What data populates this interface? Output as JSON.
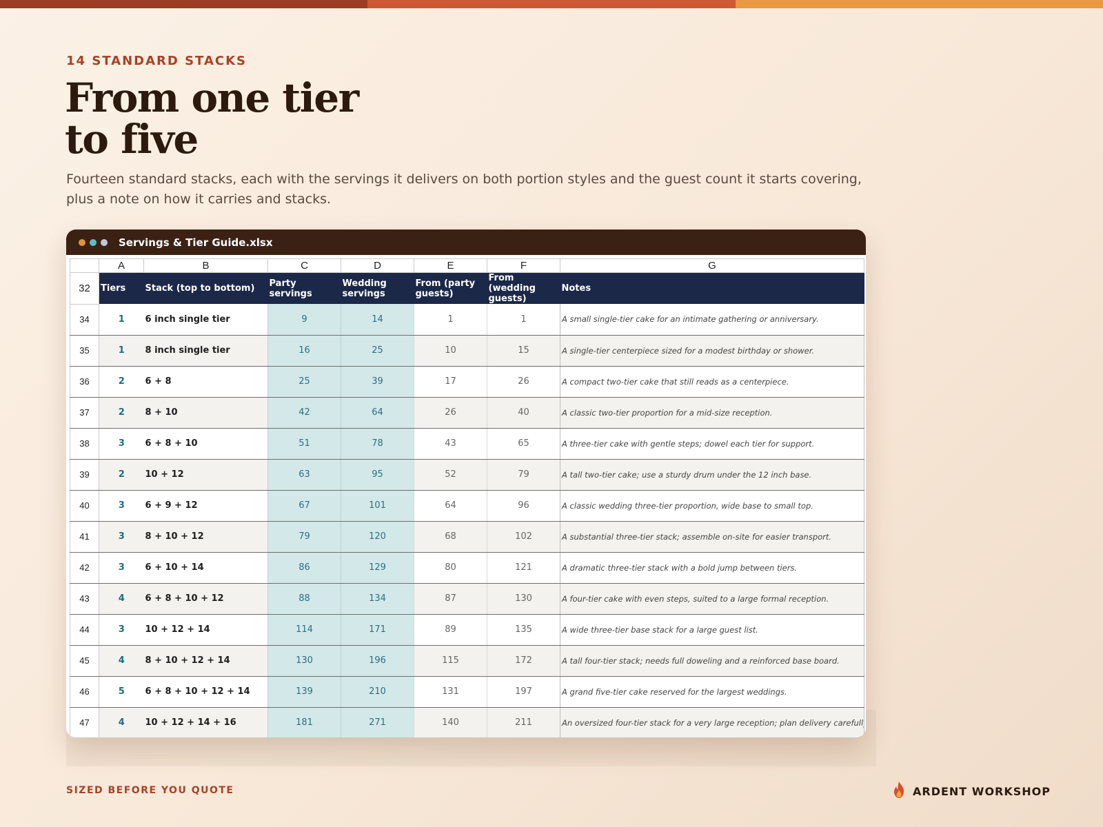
{
  "colors": {
    "top_bar": [
      "#9c3c22",
      "#cd5a35",
      "#e99942"
    ],
    "accent": "#a84226",
    "header_fill": "#1b2848",
    "servings_fill": "#d3e8e8",
    "titlebar": "#3b2114",
    "window_dots": [
      "#e98f3a",
      "#5bbfc4",
      "#c6c6d6"
    ]
  },
  "eyebrow": "14 STANDARD STACKS",
  "headline": {
    "line1": "From one tier",
    "line2": "to five"
  },
  "lede": "Fourteen standard stacks, each with the servings it delivers on both portion styles and the guest count it starts covering, plus a note on how it carries and stacks.",
  "window": {
    "title": "Servings & Tier Guide.xlsx"
  },
  "sheet": {
    "column_letters": [
      "A",
      "B",
      "C",
      "D",
      "E",
      "F",
      "G"
    ],
    "header_row_number": "32",
    "headers": [
      "Tiers",
      "Stack (top to bottom)",
      "Party servings",
      "Wedding servings",
      "From (party guests)",
      "From (wedding guests)",
      "Notes"
    ],
    "rows": [
      {
        "num": "34",
        "tiers": "1",
        "stack": "6 inch single tier",
        "party": "9",
        "wedding": "14",
        "from_party": "1",
        "from_wedding": "1",
        "note": "A small single-tier cake for an intimate gathering or anniversary."
      },
      {
        "num": "35",
        "tiers": "1",
        "stack": "8 inch single tier",
        "party": "16",
        "wedding": "25",
        "from_party": "10",
        "from_wedding": "15",
        "note": "A single-tier centerpiece sized for a modest birthday or shower."
      },
      {
        "num": "36",
        "tiers": "2",
        "stack": "6 + 8",
        "party": "25",
        "wedding": "39",
        "from_party": "17",
        "from_wedding": "26",
        "note": "A compact two-tier cake that still reads as a centerpiece."
      },
      {
        "num": "37",
        "tiers": "2",
        "stack": "8 + 10",
        "party": "42",
        "wedding": "64",
        "from_party": "26",
        "from_wedding": "40",
        "note": "A classic two-tier proportion for a mid-size reception."
      },
      {
        "num": "38",
        "tiers": "3",
        "stack": "6 + 8 + 10",
        "party": "51",
        "wedding": "78",
        "from_party": "43",
        "from_wedding": "65",
        "note": "A three-tier cake with gentle steps; dowel each tier for support."
      },
      {
        "num": "39",
        "tiers": "2",
        "stack": "10 + 12",
        "party": "63",
        "wedding": "95",
        "from_party": "52",
        "from_wedding": "79",
        "note": "A tall two-tier cake; use a sturdy drum under the 12 inch base."
      },
      {
        "num": "40",
        "tiers": "3",
        "stack": "6 + 9 + 12",
        "party": "67",
        "wedding": "101",
        "from_party": "64",
        "from_wedding": "96",
        "note": "A classic wedding three-tier proportion, wide base to small top."
      },
      {
        "num": "41",
        "tiers": "3",
        "stack": "8 + 10 + 12",
        "party": "79",
        "wedding": "120",
        "from_party": "68",
        "from_wedding": "102",
        "note": "A substantial three-tier stack; assemble on-site for easier transport."
      },
      {
        "num": "42",
        "tiers": "3",
        "stack": "6 + 10 + 14",
        "party": "86",
        "wedding": "129",
        "from_party": "80",
        "from_wedding": "121",
        "note": "A dramatic three-tier stack with a bold jump between tiers."
      },
      {
        "num": "43",
        "tiers": "4",
        "stack": "6 + 8 + 10 + 12",
        "party": "88",
        "wedding": "134",
        "from_party": "87",
        "from_wedding": "130",
        "note": "A four-tier cake with even steps, suited to a large formal reception."
      },
      {
        "num": "44",
        "tiers": "3",
        "stack": "10 + 12 + 14",
        "party": "114",
        "wedding": "171",
        "from_party": "89",
        "from_wedding": "135",
        "note": "A wide three-tier base stack for a large guest list."
      },
      {
        "num": "45",
        "tiers": "4",
        "stack": "8 + 10 + 12 + 14",
        "party": "130",
        "wedding": "196",
        "from_party": "115",
        "from_wedding": "172",
        "note": "A tall four-tier stack; needs full doweling and a reinforced base board."
      },
      {
        "num": "46",
        "tiers": "5",
        "stack": "6 + 8 + 10 + 12 + 14",
        "party": "139",
        "wedding": "210",
        "from_party": "131",
        "from_wedding": "197",
        "note": "A grand five-tier cake reserved for the largest weddings."
      },
      {
        "num": "47",
        "tiers": "4",
        "stack": "10 + 12 + 14 + 16",
        "party": "181",
        "wedding": "271",
        "from_party": "140",
        "from_wedding": "211",
        "note": "An oversized four-tier stack for a very large reception; plan delivery carefully."
      }
    ]
  },
  "footer": {
    "tagline": "SIZED BEFORE YOU QUOTE",
    "brand": "ARDENT WORKSHOP",
    "brand_icon": "flame-icon"
  }
}
